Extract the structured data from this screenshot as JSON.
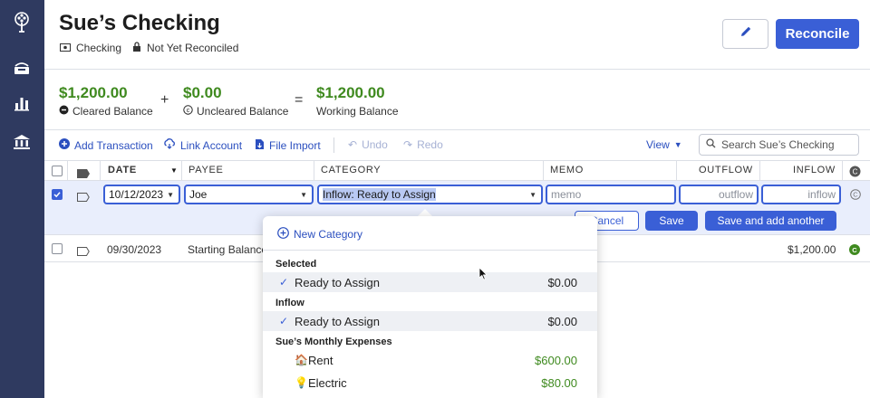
{
  "sidebar": {
    "icons": [
      "tree-logo-icon",
      "budget-icon",
      "reports-icon",
      "accounts-icon"
    ]
  },
  "header": {
    "title": "Sue’s Checking",
    "account_type": "Checking",
    "reconcile_status": "Not Yet Reconciled",
    "reconcile_label": "Reconcile"
  },
  "balances": {
    "cleared": {
      "amount": "$1,200.00",
      "label": "Cleared Balance"
    },
    "plus": "+",
    "uncleared": {
      "amount": "$0.00",
      "label": "Uncleared Balance"
    },
    "equals": "=",
    "working": {
      "amount": "$1,200.00",
      "label": "Working Balance"
    }
  },
  "toolbar": {
    "add_transaction": "Add Transaction",
    "link_account": "Link Account",
    "file_import": "File Import",
    "undo": "Undo",
    "redo": "Redo",
    "view": "View",
    "search_placeholder": "Search Sue’s Checking"
  },
  "table": {
    "columns": {
      "date": "DATE",
      "payee": "PAYEE",
      "category": "CATEGORY",
      "memo": "MEMO",
      "outflow": "OUTFLOW",
      "inflow": "INFLOW"
    },
    "edit_row": {
      "date": "10/12/2023",
      "payee": "Joe",
      "category": "Inflow: Ready to Assign",
      "memo_placeholder": "memo",
      "outflow_placeholder": "outflow",
      "inflow_placeholder": "inflow",
      "cancel_label": "Cancel",
      "save_label": "Save",
      "save_another_label": "Save and add another"
    },
    "rows": [
      {
        "date": "09/30/2023",
        "payee": "Starting Balance",
        "inflow": "$1,200.00"
      }
    ]
  },
  "category_dropdown": {
    "new_category": "New Category",
    "groups": [
      {
        "name": "Selected",
        "items": [
          {
            "name": "Ready to Assign",
            "amount": "$0.00",
            "checked": true
          }
        ]
      },
      {
        "name": "Inflow",
        "items": [
          {
            "name": "Ready to Assign",
            "amount": "$0.00",
            "checked": true
          }
        ]
      },
      {
        "name": "Sue’s Monthly Expenses",
        "items": [
          {
            "emoji": "🏠",
            "name": "Rent",
            "amount": "$600.00"
          },
          {
            "emoji": "💡",
            "name": "Electric",
            "amount": "$80.00"
          }
        ]
      }
    ]
  },
  "colors": {
    "sidebar": "#2f3a60",
    "accent": "#3a5fd6",
    "positive": "#3f8a1f",
    "row_highlight": "#e9eefc"
  }
}
